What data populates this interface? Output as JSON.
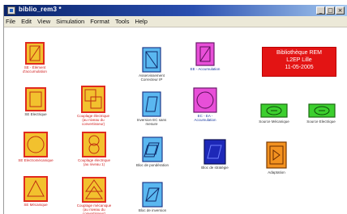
{
  "window": {
    "title": "biblio_rem3 *",
    "buttons": {
      "minimize": "_",
      "maximize": "□",
      "close": "×"
    }
  },
  "menu": [
    "File",
    "Edit",
    "View",
    "Simulation",
    "Format",
    "Tools",
    "Help"
  ],
  "banner": {
    "line1": "Bibliothèque REM",
    "line2": "L2EP Lille",
    "line3": "11-05-2005"
  },
  "blocks": {
    "sn_element": "SE - Élément d'accumulation",
    "se_electrique": "SE Electrique",
    "se_electromecanique": "SE Electromécanique",
    "se_mecanique": "SE Mécanique",
    "couplage_electrique": "Couplage électrique (au niveau du convertisseur)",
    "couplage_electromecanique": "Couplage électrique (au niveau 1)",
    "couplage_mecanique": "Couplage mécanique (au niveau du convertisseur)",
    "asservissement": "Asservissement Correcteur IP",
    "inversion_sans_mesure": "Inversion EC sans mesure",
    "bloc_pondération": "Bloc de pondération",
    "bloc_inversion": "Bloc de inversion",
    "ee_accumulation": "EE - Accumulation",
    "ee_accumulation_2": "EC - EA - Accumulation",
    "bloc_strategie": "Bloc de stratégie",
    "source_mecanique": "Source Mécanique",
    "source_electrique": "Source Electrique",
    "adaptation": "Adaptation"
  },
  "colors": {
    "titlebar_start": "#0a246a",
    "yellow_fill": "#f2c12e",
    "red_border": "#e02a1f",
    "blue_fill": "#5ab7f0",
    "magenta_fill": "#e84fd8",
    "green_fill": "#3ccf2e",
    "navy_fill": "#1d28b8",
    "orange_fill": "#f39220",
    "banner_red": "#e31414"
  },
  "icons": [
    "app-icon",
    "minimize-icon",
    "maximize-icon",
    "close-icon"
  ]
}
